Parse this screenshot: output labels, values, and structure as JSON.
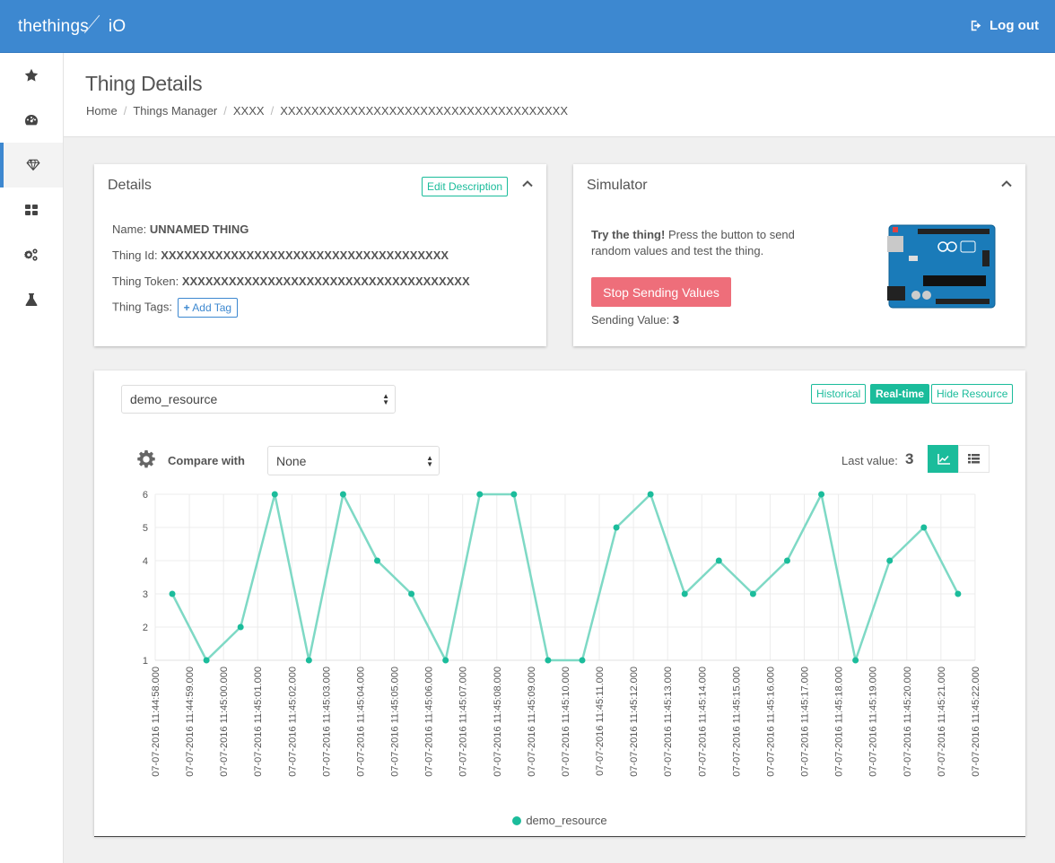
{
  "topbar": {
    "logo_left": "thethings",
    "logo_right": "iO",
    "logout_label": "Log out"
  },
  "sidebar": {
    "items": [
      {
        "icon": "star-icon"
      },
      {
        "icon": "dashboard-icon"
      },
      {
        "icon": "diamond-icon",
        "active": true
      },
      {
        "icon": "grid-icon"
      },
      {
        "icon": "gears-icon"
      },
      {
        "icon": "flask-icon"
      }
    ]
  },
  "header": {
    "title": "Thing Details",
    "breadcrumb": [
      "Home",
      "Things Manager",
      "XXXX",
      "XXXXXXXXXXXXXXXXXXXXXXXXXXXXXXXXXXXXX"
    ]
  },
  "details": {
    "title": "Details",
    "edit_label": "Edit Description",
    "name_label": "Name:",
    "name_value": "UNNAMED THING",
    "id_label": "Thing Id:",
    "id_value": "XXXXXXXXXXXXXXXXXXXXXXXXXXXXXXXXXXXXX",
    "token_label": "Thing Token:",
    "token_value": "XXXXXXXXXXXXXXXXXXXXXXXXXXXXXXXXXXXXX",
    "tags_label": "Thing Tags:",
    "add_tag_label": "Add Tag"
  },
  "simulator": {
    "title": "Simulator",
    "try_bold": "Try the thing!",
    "try_text_1": " Press the button to send",
    "try_text_2": "random values and test the thing.",
    "stop_label": "Stop Sending Values",
    "sending_label": "Sending Value:",
    "sending_value": "3"
  },
  "resource": {
    "selected": "demo_resource",
    "historical_label": "Historical",
    "realtime_label": "Real-time",
    "hide_label": "Hide Resource",
    "compare_label": "Compare with",
    "compare_selected": "None",
    "last_value_label": "Last value:",
    "last_value": "3"
  },
  "colors": {
    "brand": "#3d88d0",
    "accent": "#1bbc9b",
    "stop": "#ee6e7a",
    "line": "#7ed9c5"
  },
  "chart_data": {
    "type": "line",
    "series": [
      {
        "name": "demo_resource",
        "values": [
          3,
          1,
          2,
          6,
          1,
          6,
          4,
          3,
          1,
          6,
          6,
          1,
          1,
          5,
          6,
          3,
          4,
          3,
          4,
          6,
          1,
          4,
          5,
          3
        ]
      }
    ],
    "x_ticks": [
      "07-07-2016 11:44:58.000",
      "07-07-2016 11:44:59.000",
      "07-07-2016 11:45:00.000",
      "07-07-2016 11:45:01.000",
      "07-07-2016 11:45:02.000",
      "07-07-2016 11:45:03.000",
      "07-07-2016 11:45:04.000",
      "07-07-2016 11:45:05.000",
      "07-07-2016 11:45:06.000",
      "07-07-2016 11:45:07.000",
      "07-07-2016 11:45:08.000",
      "07-07-2016 11:45:09.000",
      "07-07-2016 11:45:10.000",
      "07-07-2016 11:45:11.000",
      "07-07-2016 11:45:12.000",
      "07-07-2016 11:45:13.000",
      "07-07-2016 11:45:14.000",
      "07-07-2016 11:45:15.000",
      "07-07-2016 11:45:16.000",
      "07-07-2016 11:45:17.000",
      "07-07-2016 11:45:18.000",
      "07-07-2016 11:45:19.000",
      "07-07-2016 11:45:20.000",
      "07-07-2016 11:45:21.000",
      "07-07-2016 11:45:22.000"
    ],
    "y_ticks": [
      "1",
      "2",
      "3",
      "4",
      "5",
      "6"
    ],
    "ylim": [
      1,
      6
    ],
    "grid": true,
    "legend": "bottom-center",
    "legend_label": "demo_resource"
  }
}
